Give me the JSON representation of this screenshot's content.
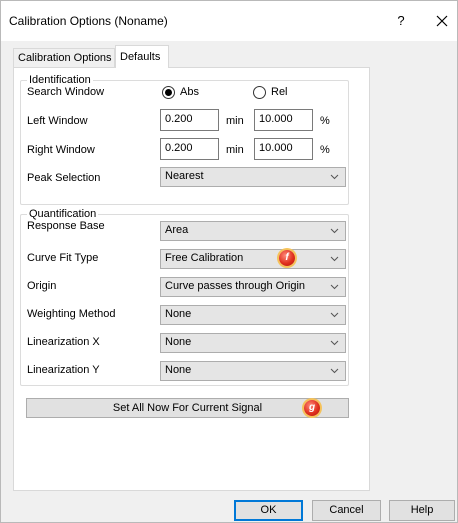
{
  "window": {
    "title": "Calibration Options (Noname)",
    "help_label": "?",
    "close_label": "✕"
  },
  "tabs": [
    {
      "label": "Calibration Options",
      "selected": false
    },
    {
      "label": "Defaults",
      "selected": true
    }
  ],
  "identification": {
    "group_label": "Identification",
    "search_window": {
      "label": "Search Window",
      "options": [
        "Abs",
        "Rel"
      ],
      "selected": "Abs"
    },
    "left_window": {
      "label": "Left Window",
      "value": "0.200",
      "unit": "min",
      "pct_value": "10.000",
      "pct_unit": "%"
    },
    "right_window": {
      "label": "Right Window",
      "value": "0.200",
      "unit": "min",
      "pct_value": "10.000",
      "pct_unit": "%"
    },
    "peak_selection": {
      "label": "Peak Selection",
      "value": "Nearest"
    }
  },
  "quantification": {
    "group_label": "Quantification",
    "response_base": {
      "label": "Response Base",
      "value": "Area"
    },
    "curve_fit_type": {
      "label": "Curve Fit Type",
      "value": "Free Calibration"
    },
    "origin": {
      "label": "Origin",
      "value": "Curve passes through Origin"
    },
    "weighting_method": {
      "label": "Weighting Method",
      "value": "None"
    },
    "linearization_x": {
      "label": "Linearization X",
      "value": "None"
    },
    "linearization_y": {
      "label": "Linearization Y",
      "value": "None"
    }
  },
  "callouts": {
    "f": "f",
    "g": "g"
  },
  "set_all_button": "Set All Now For Current Signal",
  "footer": {
    "ok": "OK",
    "cancel": "Cancel",
    "help": "Help"
  },
  "icons": {
    "dropdown": "chevron-down-icon"
  }
}
